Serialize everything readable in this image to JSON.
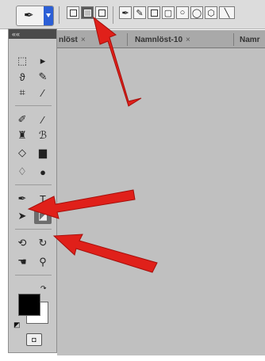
{
  "options_bar": {
    "tool_preset": {
      "icon": "pen-tool-icon"
    },
    "mode_buttons": [
      {
        "icon": "shape-layers-icon"
      },
      {
        "icon": "paths-icon",
        "selected": true
      },
      {
        "icon": "fill-pixels-icon"
      }
    ],
    "shape_buttons": [
      {
        "icon": "pen-icon"
      },
      {
        "icon": "freeform-pen-icon"
      },
      {
        "icon": "rectangle-icon"
      },
      {
        "icon": "rounded-rectangle-icon"
      },
      {
        "icon": "ellipse-icon"
      },
      {
        "icon": "polygon-icon"
      },
      {
        "icon": "line-icon"
      }
    ]
  },
  "document_tabs": [
    {
      "label": "nlöst",
      "close": "×"
    },
    {
      "label": "Namnlöst-10",
      "close": "×"
    },
    {
      "label": "Namr"
    }
  ],
  "toolbox": {
    "header": "««",
    "quick_mask_label": "◘",
    "tools": [
      {
        "icon": "marquee-icon",
        "glyph": "⬚"
      },
      {
        "icon": "move-icon",
        "glyph": "▸"
      },
      {
        "icon": "lasso-icon",
        "glyph": "ϑ"
      },
      {
        "icon": "magic-wand-icon",
        "glyph": "✎"
      },
      {
        "icon": "crop-icon",
        "glyph": "⌗"
      },
      {
        "icon": "eyedropper-icon",
        "glyph": "⁄"
      },
      {
        "icon": "healing-brush-icon",
        "glyph": "✐"
      },
      {
        "icon": "brush-icon",
        "glyph": "∕"
      },
      {
        "icon": "clone-stamp-icon",
        "glyph": "♜"
      },
      {
        "icon": "history-brush-icon",
        "glyph": "ℬ"
      },
      {
        "icon": "eraser-icon",
        "glyph": "◇"
      },
      {
        "icon": "gradient-icon",
        "glyph": "▆"
      },
      {
        "icon": "blur-icon",
        "glyph": "♢"
      },
      {
        "icon": "dodge-icon",
        "glyph": "●"
      },
      {
        "icon": "pen-tool-icon",
        "glyph": "✒"
      },
      {
        "icon": "type-icon",
        "glyph": "T"
      },
      {
        "icon": "path-selection-icon",
        "glyph": "➤"
      },
      {
        "icon": "custom-shape-icon",
        "glyph": "◪",
        "active": true
      },
      {
        "icon": "3d-rotate-icon",
        "glyph": "⟲"
      },
      {
        "icon": "3d-orbit-icon",
        "glyph": "↻"
      },
      {
        "icon": "hand-icon",
        "glyph": "☚"
      },
      {
        "icon": "zoom-icon",
        "glyph": "⚲"
      }
    ],
    "colors": {
      "foreground": "#000000",
      "background": "#ffffff"
    },
    "default_colors_icon": "default-colors-icon",
    "swap_colors_icon": "swap-colors-icon"
  },
  "annotations": {
    "arrow_color": "#e0201a",
    "arrows": [
      {
        "target": "paths-mode-button"
      },
      {
        "target": "pen-tool"
      },
      {
        "target": "custom-shape-tool"
      }
    ]
  }
}
